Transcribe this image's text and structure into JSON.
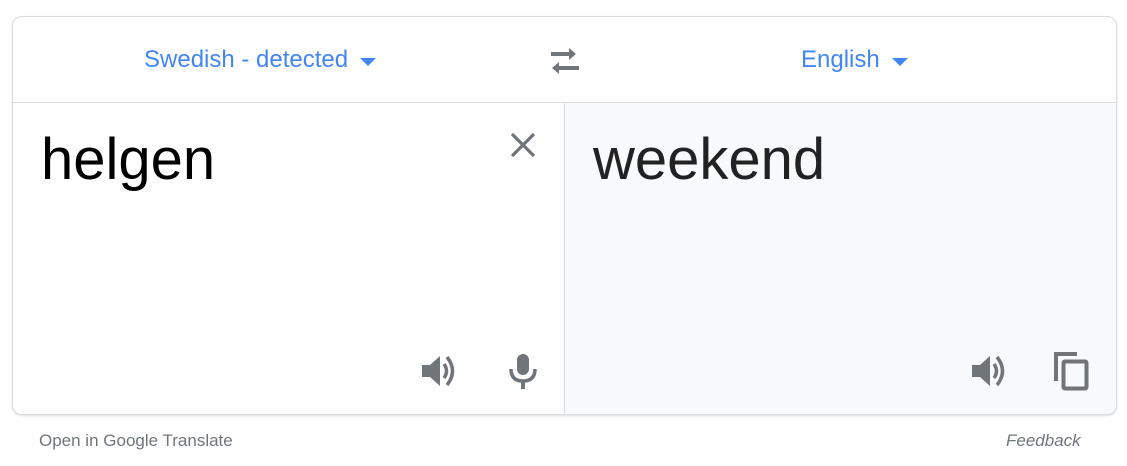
{
  "source_language": {
    "label": "Swedish - detected",
    "icon": "chevron-down-icon"
  },
  "target_language": {
    "label": "English",
    "icon": "chevron-down-icon"
  },
  "swap": {
    "icon": "swap-arrows-icon"
  },
  "source": {
    "text": "helgen",
    "clear_icon": "close-icon",
    "listen_icon": "speaker-icon",
    "mic_icon": "microphone-icon"
  },
  "target": {
    "text": "weekend",
    "listen_icon": "speaker-icon",
    "copy_icon": "copy-icon"
  },
  "footer": {
    "open_link": "Open in Google Translate",
    "feedback": "Feedback"
  },
  "colors": {
    "accent": "#4285f4",
    "icon": "#70757a",
    "target_bg": "#f8f9fa",
    "border": "#dadce0"
  }
}
